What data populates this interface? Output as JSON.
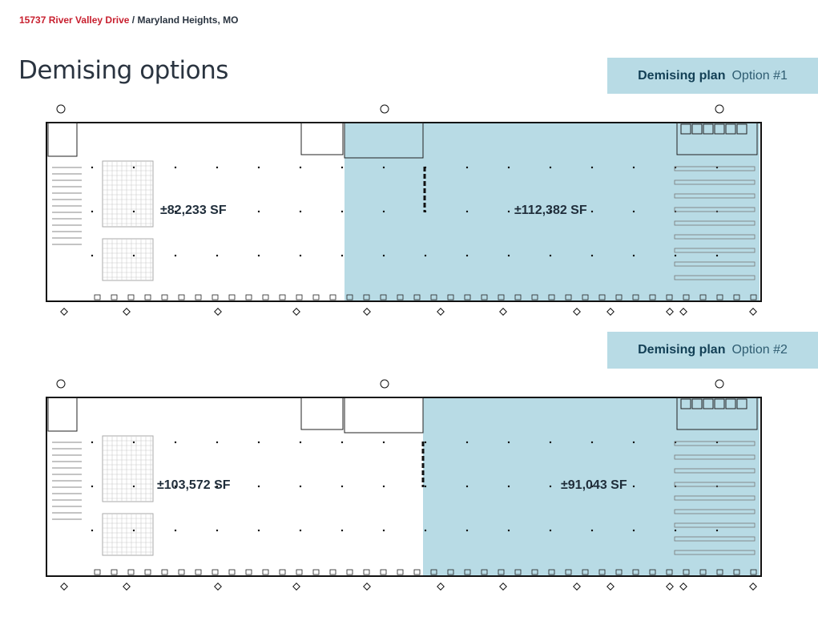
{
  "header": {
    "address": "15737 River Valley Drive",
    "separator": " / ",
    "city": "Maryland Heights, MO"
  },
  "page_title": "Demising options",
  "colors": {
    "accent_red": "#c8202f",
    "shade_blue": "#b8dbe5",
    "badge_text": "#123f55"
  },
  "options": [
    {
      "label": "Demising plan",
      "option": "Option #1",
      "left_sf": "±82,233 SF",
      "right_sf": "±112,382 SF"
    },
    {
      "label": "Demising plan",
      "option": "Option #2",
      "left_sf": "±103,572 SF",
      "right_sf": "±91,043 SF"
    }
  ]
}
